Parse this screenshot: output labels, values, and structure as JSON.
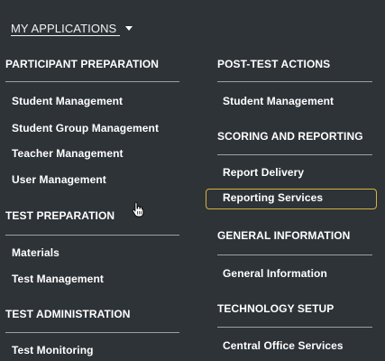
{
  "menu": {
    "toggle_label": "MY APPLICATIONS ",
    "left_column": {
      "sections": [
        {
          "heading": "PARTICIPANT PREPARATION",
          "items": [
            "Student Management",
            "Student Group Management",
            "Teacher Management",
            "User Management"
          ]
        },
        {
          "heading": "TEST PREPARATION",
          "items": [
            "Materials",
            "Test Management"
          ]
        },
        {
          "heading": "TEST ADMINISTRATION",
          "items": [
            "Test Monitoring"
          ]
        }
      ]
    },
    "right_column": {
      "sections": [
        {
          "heading": "POST-TEST ACTIONS",
          "items": [
            "Student Management"
          ]
        },
        {
          "heading": "SCORING AND REPORTING",
          "items": [
            "Report Delivery",
            "Reporting Services"
          ]
        },
        {
          "heading": "GENERAL INFORMATION",
          "items": [
            "General Information"
          ]
        },
        {
          "heading": "TECHNOLOGY SETUP",
          "items": [
            "Central Office Services"
          ]
        }
      ]
    },
    "highlighted_item": "Reporting Services",
    "colors": {
      "background": "#2e3338",
      "text": "#ffffff",
      "divider": "#9aa0a6",
      "highlight_border": "#d8b23a"
    }
  }
}
